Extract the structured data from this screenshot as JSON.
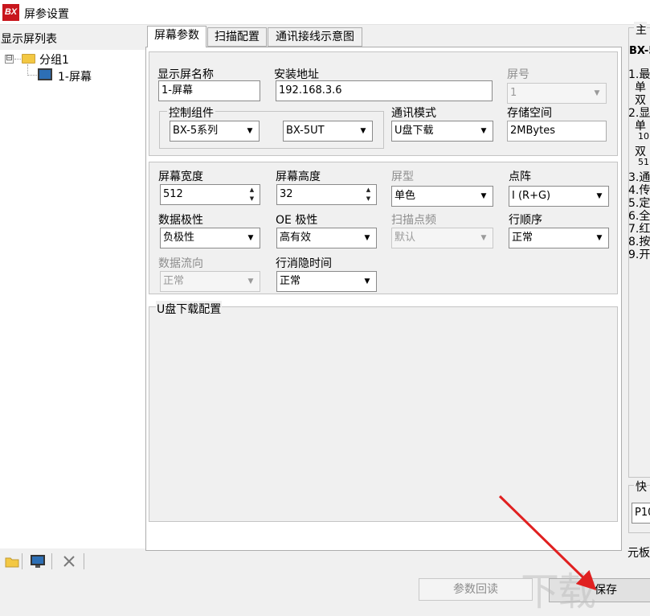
{
  "window": {
    "title": "屏参设置",
    "icon_text": "BX"
  },
  "left_panel": {
    "title": "显示屏列表",
    "tree": {
      "group_label": "分组1",
      "expander": "⊟",
      "screen_label": "1-屏幕"
    },
    "toolbar": [
      "folder-icon",
      "monitor-icon",
      "close-icon"
    ]
  },
  "tabs": [
    "屏幕参数",
    "扫描配置",
    "通讯接线示意图"
  ],
  "screen_params": {
    "name_label": "显示屏名称",
    "name_value": "1-屏幕",
    "address_label": "安装地址",
    "address_value": "192.168.3.6",
    "screen_no_label": "屏号",
    "screen_no_value": "1",
    "control_group_label": "控制组件",
    "series_value": "BX-5系列",
    "model_value": "BX-5UT",
    "comm_mode_label": "通讯模式",
    "comm_mode_value": "U盘下载",
    "storage_label": "存储空间",
    "storage_value": "2MBytes"
  },
  "display_params": {
    "width_label": "屏幕宽度",
    "width_value": "512",
    "height_label": "屏幕高度",
    "height_value": "32",
    "type_label": "屏型",
    "type_value": "单色",
    "matrix_label": "点阵",
    "matrix_value": "I (R+G)",
    "polarity_label": "数据极性",
    "polarity_value": "负极性",
    "oe_label": "OE 极性",
    "oe_value": "高有效",
    "scan_freq_label": "扫描点频",
    "scan_freq_value": "默认",
    "row_order_label": "行顺序",
    "row_order_value": "正常",
    "data_flow_label": "数据流向",
    "data_flow_value": "正常",
    "blank_time_label": "行消隐时间",
    "blank_time_value": "正常"
  },
  "udisk": {
    "title": "U盘下载配置"
  },
  "right_panel": {
    "title_fragment": "主",
    "bx_fragment": "BX-5",
    "lines": [
      "1.最",
      "单",
      "双",
      "2.显",
      "单",
      "10",
      "双",
      "51",
      "3.通",
      "4.传",
      "5.定",
      "6.全",
      "7.红",
      "8.按",
      "9.开"
    ],
    "quick_label": "快",
    "quick_value": "P10",
    "board_label": "元板"
  },
  "buttons": {
    "read_params": "参数回读",
    "save": "保存"
  },
  "watermark": "下载"
}
